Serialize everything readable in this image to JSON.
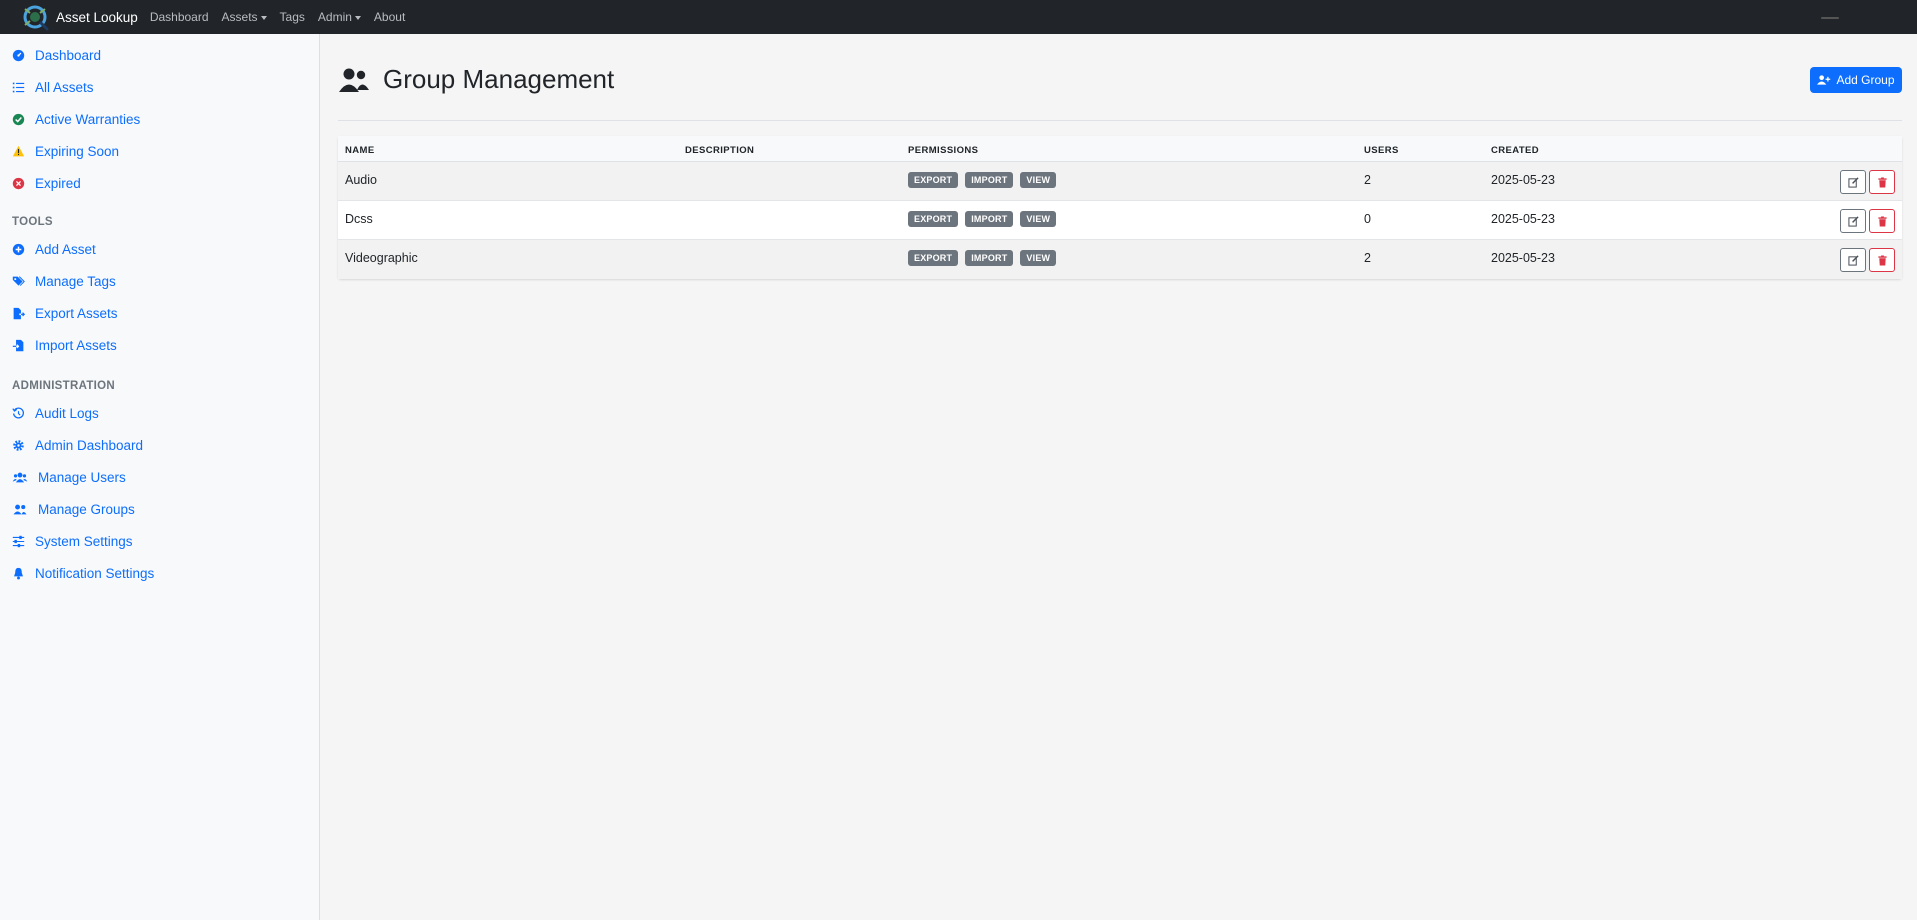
{
  "navbar": {
    "brand": "Asset Lookup",
    "links": [
      {
        "label": "Dashboard",
        "dropdown": false
      },
      {
        "label": "Assets",
        "dropdown": true
      },
      {
        "label": "Tags",
        "dropdown": false
      },
      {
        "label": "Admin",
        "dropdown": true
      },
      {
        "label": "About",
        "dropdown": false
      }
    ]
  },
  "sidebar": {
    "main": [
      {
        "label": "Dashboard",
        "icon": "gauge-icon",
        "color": "#0d6efd"
      },
      {
        "label": "All Assets",
        "icon": "list-icon",
        "color": "#0d6efd"
      },
      {
        "label": "Active Warranties",
        "icon": "check-circle-icon",
        "color": "#198754"
      },
      {
        "label": "Expiring Soon",
        "icon": "warning-triangle-icon",
        "color": "#ffc107"
      },
      {
        "label": "Expired",
        "icon": "x-circle-icon",
        "color": "#dc3545"
      }
    ],
    "tools_heading": "TOOLS",
    "tools": [
      {
        "label": "Add Asset",
        "icon": "plus-circle-icon"
      },
      {
        "label": "Manage Tags",
        "icon": "tags-icon"
      },
      {
        "label": "Export Assets",
        "icon": "file-export-icon"
      },
      {
        "label": "Import Assets",
        "icon": "file-import-icon"
      }
    ],
    "admin_heading": "ADMINISTRATION",
    "admin": [
      {
        "label": "Audit Logs",
        "icon": "history-icon"
      },
      {
        "label": "Admin Dashboard",
        "icon": "gear-icon"
      },
      {
        "label": "Manage Users",
        "icon": "users-icon"
      },
      {
        "label": "Manage Groups",
        "icon": "user-group-icon"
      },
      {
        "label": "System Settings",
        "icon": "sliders-icon"
      },
      {
        "label": "Notification Settings",
        "icon": "bell-icon"
      }
    ]
  },
  "main": {
    "title": "Group Management",
    "add_button": "Add Group",
    "columns": {
      "name": "NAME",
      "description": "DESCRIPTION",
      "permissions": "PERMISSIONS",
      "users": "USERS",
      "created": "CREATED"
    },
    "rows": [
      {
        "name": "Audio",
        "description": "",
        "permissions": [
          "EXPORT",
          "IMPORT",
          "VIEW"
        ],
        "users": "2",
        "created": "2025-05-23"
      },
      {
        "name": "Dcss",
        "description": "",
        "permissions": [
          "EXPORT",
          "IMPORT",
          "VIEW"
        ],
        "users": "0",
        "created": "2025-05-23"
      },
      {
        "name": "Videographic",
        "description": "",
        "permissions": [
          "EXPORT",
          "IMPORT",
          "VIEW"
        ],
        "users": "2",
        "created": "2025-05-23"
      }
    ]
  },
  "colors": {
    "accent": "#0d6efd",
    "navbar": "#212529",
    "danger": "#dc3545",
    "badge": "#6c757d"
  }
}
